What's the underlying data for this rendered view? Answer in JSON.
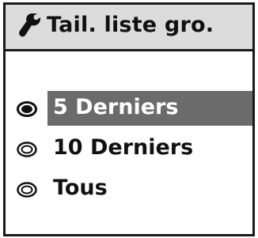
{
  "header": {
    "title": "Tail. liste gro.",
    "icon": "wrench-icon"
  },
  "options": [
    {
      "label": "5 Derniers",
      "selected": true
    },
    {
      "label": "10 Derniers",
      "selected": false
    },
    {
      "label": "Tous",
      "selected": false
    }
  ],
  "colors": {
    "title_bar": "#dcdcdc",
    "highlight": "#6b6b6b",
    "border": "#1a1a1a"
  }
}
